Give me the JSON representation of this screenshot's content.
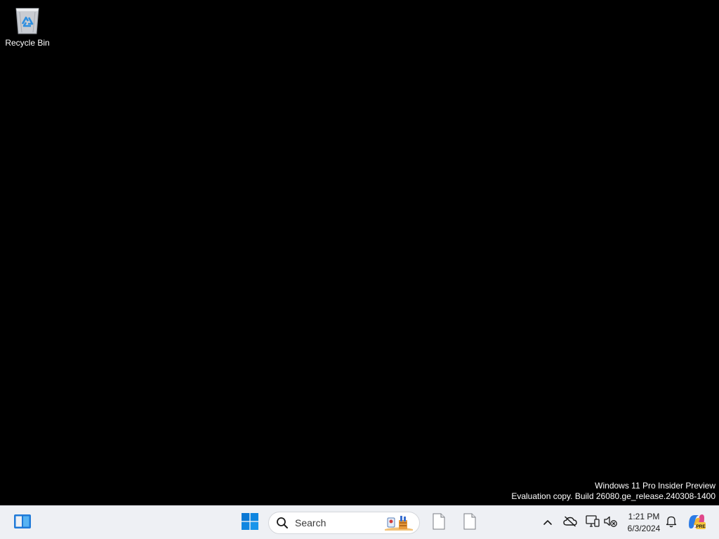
{
  "desktop": {
    "background": "#000000",
    "icons": [
      {
        "label": "Recycle Bin",
        "icon": "recycle-bin-icon"
      }
    ],
    "watermark": {
      "line1": "Windows 11 Pro Insider Preview",
      "line2": "Evaluation copy. Build 26080.ge_release.240308-1400"
    }
  },
  "taskbar": {
    "background": "#eef0f4",
    "widgets": {
      "icon": "widgets-icon"
    },
    "start": {
      "icon": "windows-logo-icon",
      "accent": "#0a78d4"
    },
    "search": {
      "placeholder": "Search",
      "icon": "search-icon",
      "highlight_icon": "search-highlight-icon"
    },
    "pinned": [
      {
        "icon": "blank-file-icon"
      },
      {
        "icon": "blank-file-icon"
      }
    ],
    "tray": {
      "icons": [
        "chevron-up-icon",
        "onedrive-offline-icon",
        "network-icon",
        "volume-muted-icon"
      ],
      "time": "1:21 PM",
      "date": "6/3/2024",
      "notifications_icon": "bell-icon",
      "copilot_icon": "copilot-icon",
      "copilot_badge": "PRE"
    }
  }
}
